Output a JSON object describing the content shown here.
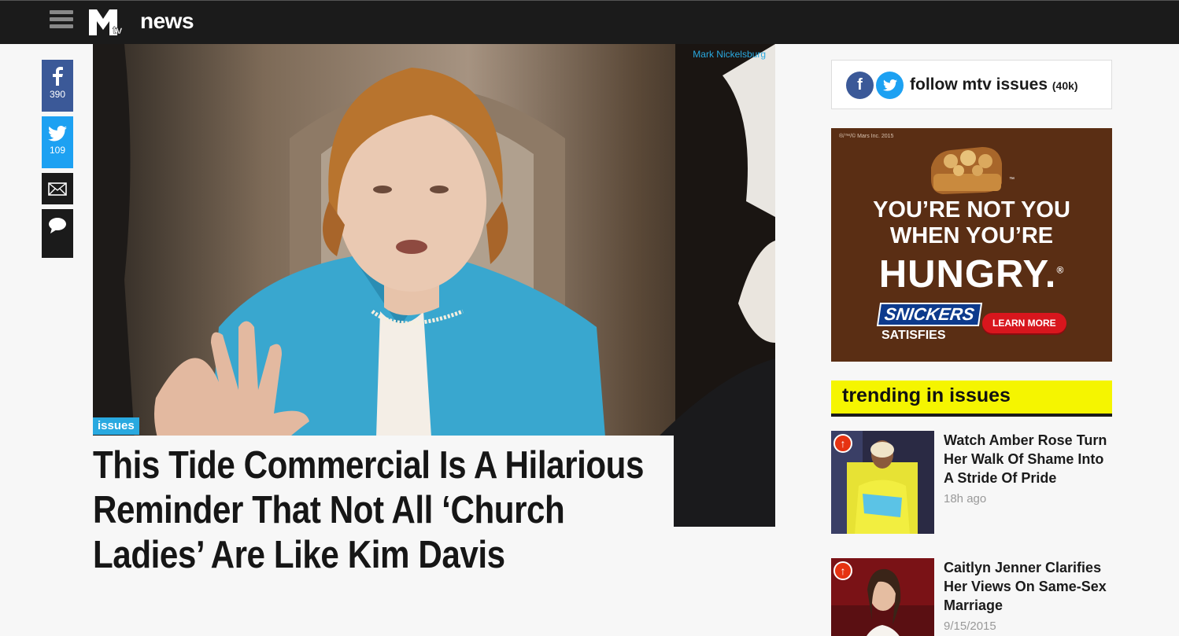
{
  "nav": {
    "menu_icon": "hamburger-icon",
    "logo": "MTV",
    "brand": "news"
  },
  "share": {
    "facebook_count": "390",
    "twitter_count": "109",
    "icons": [
      "facebook-icon",
      "twitter-icon",
      "email-icon",
      "comment-icon"
    ]
  },
  "article": {
    "photo_credit": "Mark Nickelsburg",
    "tag": "issues",
    "headline": "This Tide Commercial Is A Hilarious Reminder That Not All ‘Church Ladies’ Are Like Kim Davis"
  },
  "follow": {
    "label": "follow mtv issues",
    "count": "(40k)"
  },
  "ad": {
    "legal": "®/™/© Mars Inc. 2015",
    "tm": "™",
    "line1": "YOU’RE NOT YOU",
    "line2": "WHEN YOU’RE",
    "line3": "HUNGRY.",
    "reg": "®",
    "brand": "SNICKERS",
    "tagline": "SATISFIES",
    "cta": "LEARN MORE"
  },
  "trending": {
    "heading": "trending in issues",
    "items": [
      {
        "title": "Watch Amber Rose Turn Her Walk Of Shame Into A Stride Of Pride",
        "time": "18h ago"
      },
      {
        "title": "Caitlyn Jenner Clarifies Her Views On Same-Sex Marriage",
        "time": "9/15/2015"
      }
    ]
  },
  "colors": {
    "topbar": "#1b1b1b",
    "accent_blue": "#29a9e0",
    "facebook": "#3b5998",
    "twitter": "#1da1f2",
    "trending_yellow": "#f5f500"
  }
}
